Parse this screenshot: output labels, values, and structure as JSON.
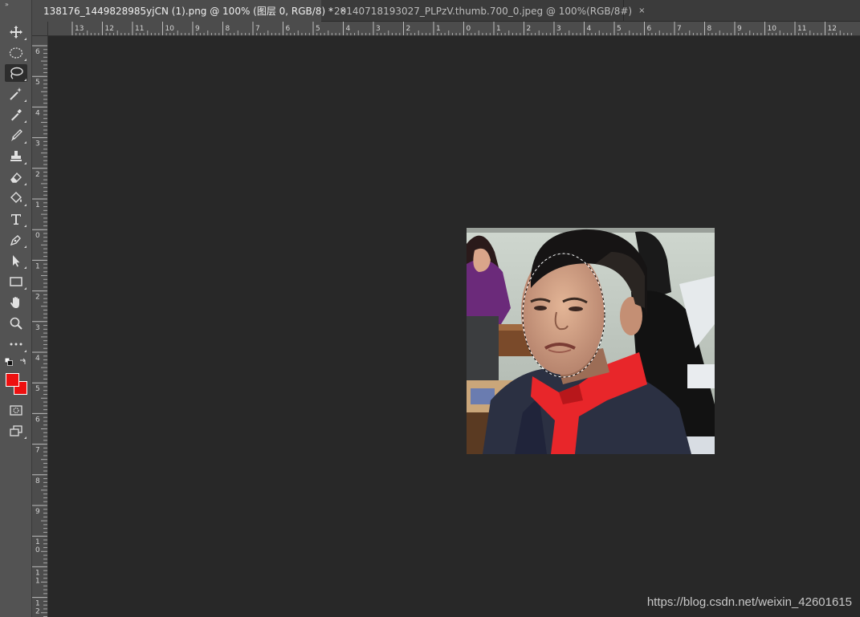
{
  "tabs": [
    {
      "label": "138176_1449828985yjCN (1).png @ 100% (图层 0, RGB/8) *",
      "close": "×",
      "active": true
    },
    {
      "label": "20140718193027_PLPzV.thumb.700_0.jpeg @ 100%(RGB/8#)",
      "close": "×",
      "active": false
    }
  ],
  "toolbar": {
    "grip": "»",
    "tools": [
      {
        "name": "move-tool",
        "icon": "move-icon"
      },
      {
        "name": "elliptical-marquee-tool",
        "icon": "ellipse-marquee-icon"
      },
      {
        "name": "lasso-tool",
        "icon": "lasso-icon",
        "active": true
      },
      {
        "name": "magic-wand-tool",
        "icon": "magic-wand-icon"
      },
      {
        "name": "eyedropper-tool",
        "icon": "eyedropper-icon"
      },
      {
        "name": "brush-tool",
        "icon": "brush-icon"
      },
      {
        "name": "clone-stamp-tool",
        "icon": "stamp-icon"
      },
      {
        "name": "eraser-tool",
        "icon": "eraser-icon"
      },
      {
        "name": "paint-bucket-tool",
        "icon": "bucket-icon"
      },
      {
        "name": "type-tool",
        "icon": "type-icon"
      },
      {
        "name": "pen-tool",
        "icon": "pen-icon"
      },
      {
        "name": "path-selection-tool",
        "icon": "arrow-icon"
      },
      {
        "name": "rectangle-tool",
        "icon": "rectangle-icon"
      },
      {
        "name": "hand-tool",
        "icon": "hand-icon"
      },
      {
        "name": "zoom-tool",
        "icon": "zoom-icon"
      },
      {
        "name": "more-tools",
        "icon": "more-icon"
      }
    ],
    "foreground_color": "#ee1010",
    "background_color": "#ee1010"
  },
  "ruler_top_labels": [
    "13",
    "12",
    "11",
    "10",
    "9",
    "8",
    "7",
    "6",
    "5",
    "4",
    "3",
    "2",
    "1",
    "0",
    "1",
    "2",
    "3",
    "4",
    "5",
    "6",
    "7",
    "8",
    "9",
    "10",
    "11",
    "12"
  ],
  "ruler_left_labels": [
    "6",
    "5",
    "4",
    "3",
    "2",
    "1",
    "0",
    "1",
    "2",
    "3",
    "4",
    "5",
    "6",
    "7",
    "8",
    "9",
    "10",
    "11",
    "12"
  ],
  "watermark": "https://blog.csdn.net/weixin_42601615",
  "colors": {
    "canvas": "#282828",
    "panel": "#535353",
    "selection": "#000000"
  }
}
